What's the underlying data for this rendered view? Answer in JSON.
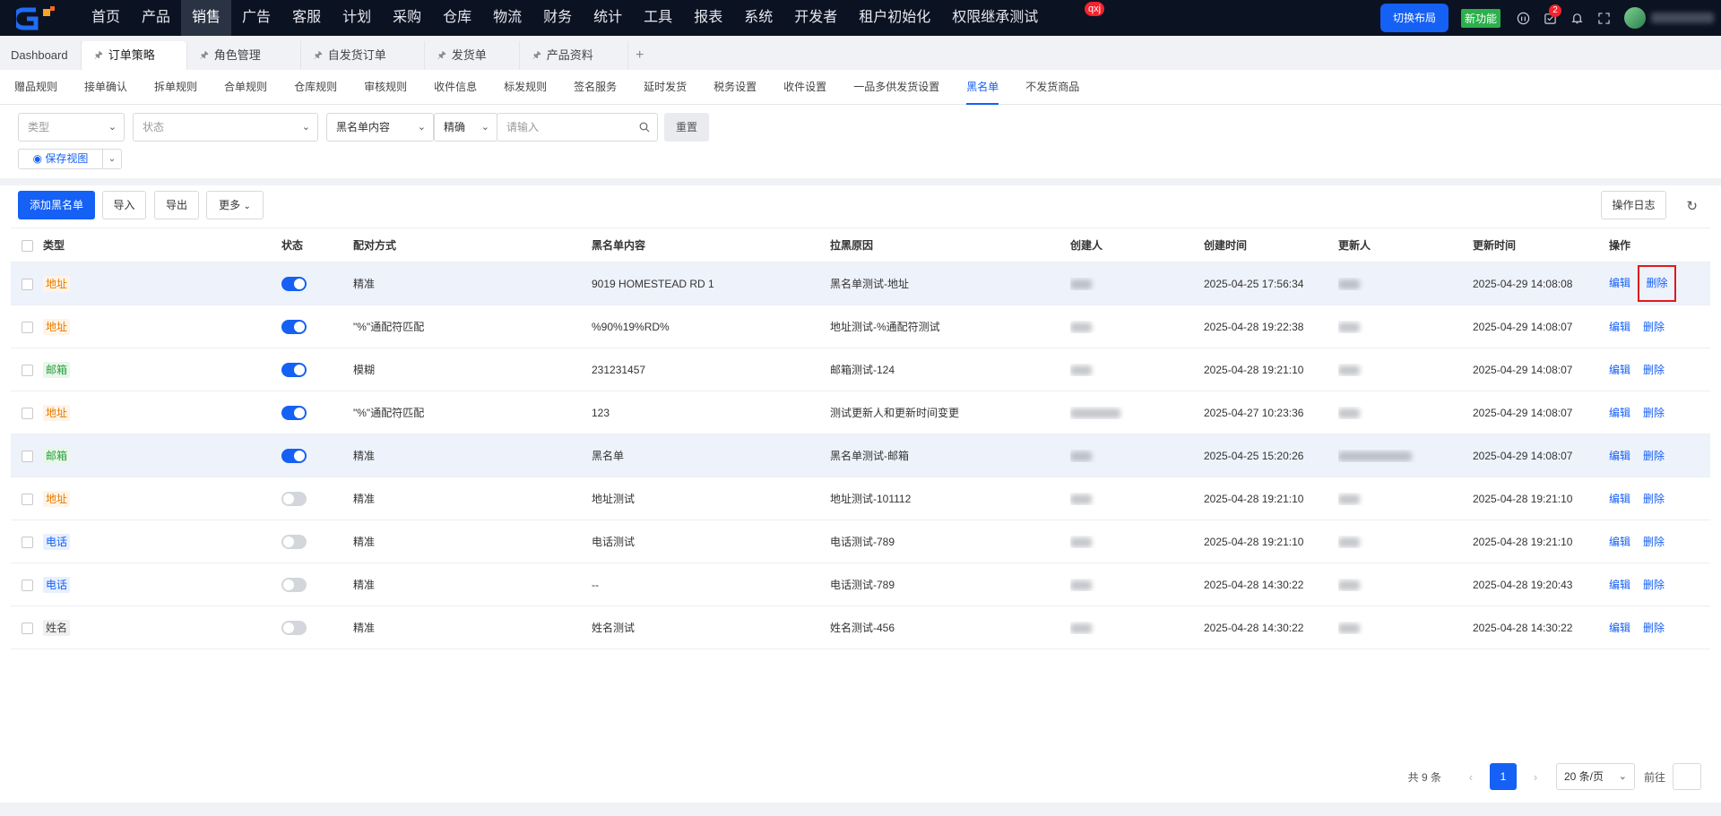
{
  "topnav": {
    "items": [
      "首页",
      "产品",
      "销售",
      "广告",
      "客服",
      "计划",
      "采购",
      "仓库",
      "物流",
      "财务",
      "统计",
      "工具",
      "报表",
      "系统",
      "开发者",
      "租户初始化",
      "权限继承测试"
    ],
    "active_index": 2,
    "switch_layout": "切换布局",
    "new_feature": "新功能",
    "notification_count": "2",
    "qxj_badge": "qxj"
  },
  "tabs": [
    {
      "label": "Dashboard"
    },
    {
      "label": "订单策略"
    },
    {
      "label": "角色管理"
    },
    {
      "label": "自发货订单"
    },
    {
      "label": "发货单"
    },
    {
      "label": "产品资料"
    }
  ],
  "tab_add": "+",
  "tab_close": "×",
  "subtabs": [
    "赠品规则",
    "接单确认",
    "拆单规则",
    "合单规则",
    "仓库规则",
    "审核规则",
    "收件信息",
    "标发规则",
    "签名服务",
    "延时发货",
    "税务设置",
    "收件设置",
    "一品多供发货设置",
    "黑名单",
    "不发货商品"
  ],
  "subtab_active": 13,
  "filters": {
    "type_placeholder": "类型",
    "status_placeholder": "状态",
    "field_select": "黑名单内容",
    "match_select": "精确",
    "search_placeholder": "请输入",
    "reset": "重置",
    "save_view": "保存视图"
  },
  "toolbar": {
    "add": "添加黑名单",
    "import": "导入",
    "export": "导出",
    "more": "更多",
    "op_log": "操作日志"
  },
  "table": {
    "headers": {
      "type": "类型",
      "status": "状态",
      "match": "配对方式",
      "content": "黑名单内容",
      "reason": "拉黑原因",
      "creator": "创建人",
      "ctime": "创建时间",
      "updater": "更新人",
      "utime": "更新时间",
      "op": "操作"
    },
    "edit": "编辑",
    "delete": "删除",
    "rows": [
      {
        "type": "地址",
        "tag": "addr",
        "status": true,
        "match": "精准",
        "content": "9019 HOMESTEAD RD 1",
        "reason": "黑名单测试-地址",
        "ctime": "2025-04-25 17:56:34",
        "utime": "2025-04-29 14:08:08",
        "highlight": true,
        "del_box": true,
        "creator_w": 24,
        "updater_w": 24
      },
      {
        "type": "地址",
        "tag": "addr",
        "status": true,
        "match": "\"%\"通配符匹配",
        "content": "%90%19%RD%",
        "reason": "地址测试-%通配符测试",
        "ctime": "2025-04-28 19:22:38",
        "utime": "2025-04-29 14:08:07",
        "highlight": false,
        "del_box": false,
        "creator_w": 24,
        "updater_w": 24
      },
      {
        "type": "邮箱",
        "tag": "mail",
        "status": true,
        "match": "模糊",
        "content": "231231457",
        "reason": "邮箱测试-124",
        "ctime": "2025-04-28 19:21:10",
        "utime": "2025-04-29 14:08:07",
        "highlight": false,
        "del_box": false,
        "creator_w": 24,
        "updater_w": 24
      },
      {
        "type": "地址",
        "tag": "addr",
        "status": true,
        "match": "\"%\"通配符匹配",
        "content": "123",
        "reason": "测试更新人和更新时间变更",
        "ctime": "2025-04-27 10:23:36",
        "utime": "2025-04-29 14:08:07",
        "highlight": false,
        "del_box": false,
        "creator_w": 56,
        "updater_w": 24
      },
      {
        "type": "邮箱",
        "tag": "mail",
        "status": true,
        "match": "精准",
        "content": "黑名单",
        "reason": "黑名单测试-邮箱",
        "ctime": "2025-04-25 15:20:26",
        "utime": "2025-04-29 14:08:07",
        "highlight": true,
        "del_box": false,
        "creator_w": 24,
        "updater_w": 82
      },
      {
        "type": "地址",
        "tag": "addr",
        "status": false,
        "match": "精准",
        "content": "地址测试",
        "reason": "地址测试-101112",
        "ctime": "2025-04-28 19:21:10",
        "utime": "2025-04-28 19:21:10",
        "highlight": false,
        "del_box": false,
        "creator_w": 24,
        "updater_w": 24
      },
      {
        "type": "电话",
        "tag": "phone",
        "status": false,
        "match": "精准",
        "content": "电话测试",
        "reason": "电话测试-789",
        "ctime": "2025-04-28 19:21:10",
        "utime": "2025-04-28 19:21:10",
        "highlight": false,
        "del_box": false,
        "creator_w": 24,
        "updater_w": 24
      },
      {
        "type": "电话",
        "tag": "phone",
        "status": false,
        "match": "精准",
        "content": "--",
        "reason": "电话测试-789",
        "ctime": "2025-04-28 14:30:22",
        "utime": "2025-04-28 19:20:43",
        "highlight": false,
        "del_box": false,
        "creator_w": 24,
        "updater_w": 24
      },
      {
        "type": "姓名",
        "tag": "name",
        "status": false,
        "match": "精准",
        "content": "姓名测试",
        "reason": "姓名测试-456",
        "ctime": "2025-04-28 14:30:22",
        "utime": "2025-04-28 14:30:22",
        "highlight": false,
        "del_box": false,
        "creator_w": 24,
        "updater_w": 24
      }
    ]
  },
  "pagination": {
    "total": "共 9 条",
    "current": "1",
    "page_size": "20 条/页",
    "goto": "前往"
  },
  "colors": {
    "accent": "#1560f5",
    "nav_bg": "#0b1222"
  }
}
